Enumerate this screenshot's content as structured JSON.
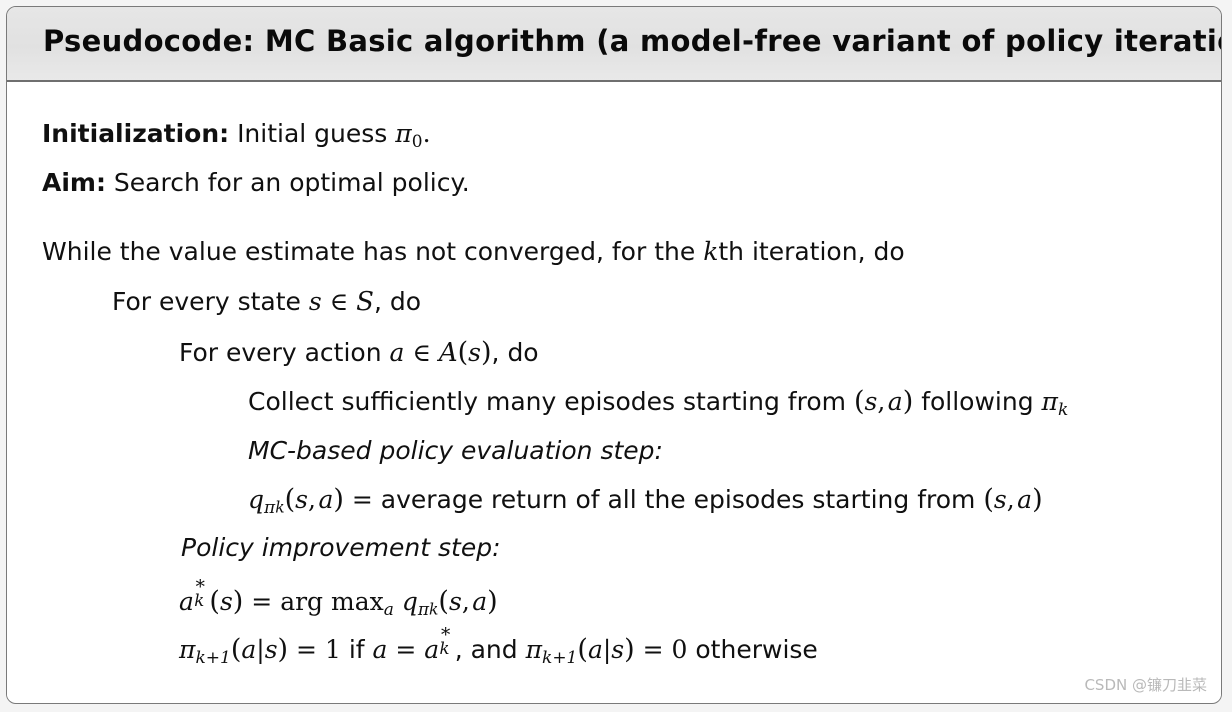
{
  "box": {
    "title": "Pseudocode: MC Basic algorithm (a model-free variant of policy iteration)"
  },
  "body": {
    "initialization_label": "Initialization:",
    "initialization_text": "Initial guess",
    "initialization_symbol": "π",
    "initialization_symbol_sub": "0",
    "initialization_period": ".",
    "aim_label": "Aim:",
    "aim_text": "Search for an optimal policy.",
    "while_pre": "While the value estimate has not converged, for the",
    "while_k": "k",
    "while_post": "th iteration, do",
    "for_state_pre": "For every state",
    "for_state_s": "s",
    "for_state_in": "∈",
    "for_state_set": "𝑆",
    "for_state_post": ", do",
    "for_action_pre": "For every action",
    "for_action_a": "a",
    "for_action_in": "∈",
    "for_action_set": "𝐴",
    "for_action_arg_open": "(",
    "for_action_arg_s": "s",
    "for_action_arg_close": ")",
    "for_action_post": ", do",
    "collect_pre": "Collect sufficiently many episodes starting from",
    "collect_pair_open": "(",
    "collect_pair_s": "s",
    "collect_pair_comma": ",",
    "collect_pair_a": "a",
    "collect_pair_close": ")",
    "collect_post": "following",
    "collect_pi": "π",
    "collect_pi_sub": "k",
    "mc_eval_step": "MC-based policy evaluation step:",
    "q_sym": "q",
    "q_pi": "π",
    "q_pi_sub": "k",
    "q_args_open": "(",
    "q_arg_s": "s",
    "q_arg_comma": ",",
    "q_arg_a": "a",
    "q_args_close": ")",
    "q_equals": "=",
    "q_text": "average return of all the episodes starting from",
    "q_pair_open": "(",
    "q_pair_s": "s",
    "q_pair_comma": ",",
    "q_pair_a": "a",
    "q_pair_close": ")",
    "policy_improvement_step": "Policy improvement step:",
    "astar_a": "a",
    "astar_sup": "∗",
    "astar_sub": "k",
    "astar_open": "(",
    "astar_s": "s",
    "astar_close": ")",
    "astar_equals": "=",
    "astar_argmax": "arg max",
    "astar_argmax_sub": "a",
    "astar_q": "q",
    "astar_q_pi": "π",
    "astar_q_pi_sub": "k",
    "astar_q_open": "(",
    "astar_q_s": "s",
    "astar_q_comma": ",",
    "astar_q_a": "a",
    "astar_q_close": ")",
    "pi_next": "π",
    "pi_next_sub": "k+1",
    "pi_next_open": "(",
    "pi_next_a": "a",
    "pi_next_bar": "|",
    "pi_next_s": "s",
    "pi_next_close": ")",
    "pi_next_equals": "=",
    "pi_next_one": "1",
    "pi_next_if": "if",
    "pi_next_if_a": "a",
    "pi_next_if_eq": "=",
    "pi_next_if_astar": "a",
    "pi_next_if_astar_sup": "∗",
    "pi_next_if_astar_sub": "k",
    "pi_next_comma_and": ", and",
    "pi_next2": "π",
    "pi_next2_sub": "k+1",
    "pi_next2_open": "(",
    "pi_next2_a": "a",
    "pi_next2_bar": "|",
    "pi_next2_s": "s",
    "pi_next2_close": ")",
    "pi_next2_equals": "=",
    "pi_next2_zero": "0",
    "pi_next2_otherwise": "otherwise"
  },
  "watermark": {
    "text": "CSDN @镰刀韭菜"
  },
  "colors": {
    "header_bg": "#e2e2e2",
    "border": "#7a7a7a",
    "body_bg": "#ffffff",
    "text": "#101010",
    "watermark": "#b9b9b9"
  }
}
